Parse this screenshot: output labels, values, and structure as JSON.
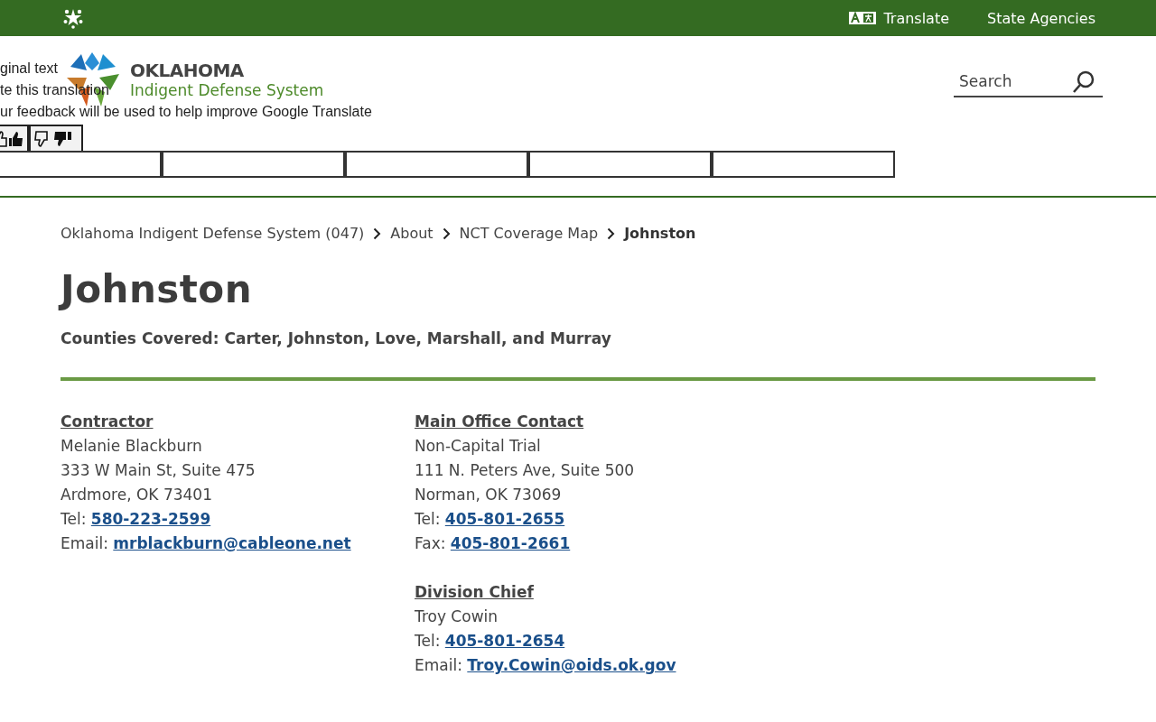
{
  "top_bar": {
    "translate": "Translate",
    "state_agencies": "State Agencies"
  },
  "header": {
    "logo": {
      "title": "OKLAHOMA",
      "subtitle": "Indigent Defense System"
    },
    "search": {
      "placeholder": "Search"
    }
  },
  "translate_popup": {
    "lines": [
      "ginal text",
      "te this translation",
      "ur feedback will be used to help improve Google Translate"
    ]
  },
  "breadcrumb": [
    {
      "label": "Oklahoma Indigent Defense System (047)",
      "current": false
    },
    {
      "label": "About",
      "current": false
    },
    {
      "label": "NCT Coverage Map",
      "current": false
    },
    {
      "label": "Johnston",
      "current": true
    }
  ],
  "title": "Johnston",
  "counties": "Counties Covered: Carter, Johnston, Love, Marshall, and Murray",
  "columns": [
    [
      {
        "heading": "Contractor",
        "lines": [
          {
            "kind": "text",
            "text": "Melanie Blackburn"
          },
          {
            "kind": "text",
            "text": "333 W Main St, Suite 475"
          },
          {
            "kind": "text",
            "text": "Ardmore, OK 73401"
          },
          {
            "kind": "link",
            "label": "Tel:",
            "text": "580-223-2599"
          },
          {
            "kind": "link",
            "label": "Email:",
            "text": "mrblackburn@cableone.net"
          }
        ]
      }
    ],
    [
      {
        "heading": "Main Office Contact",
        "lines": [
          {
            "kind": "text",
            "text": "Non-Capital Trial"
          },
          {
            "kind": "text",
            "text": "111 N. Peters Ave, Suite 500"
          },
          {
            "kind": "text",
            "text": "Norman, OK 73069"
          },
          {
            "kind": "link",
            "label": "Tel:",
            "text": "405-801-2655"
          },
          {
            "kind": "link",
            "label": "Fax:",
            "text": "405-801-2661"
          }
        ]
      },
      {
        "heading": "Division Chief",
        "lines": [
          {
            "kind": "text",
            "text": "Troy Cowin"
          },
          {
            "kind": "link",
            "label": "Tel:",
            "text": "405-801-2654"
          },
          {
            "kind": "link",
            "label": "Email:",
            "text": "Troy.Cowin@oids.ok.gov"
          }
        ]
      }
    ]
  ]
}
